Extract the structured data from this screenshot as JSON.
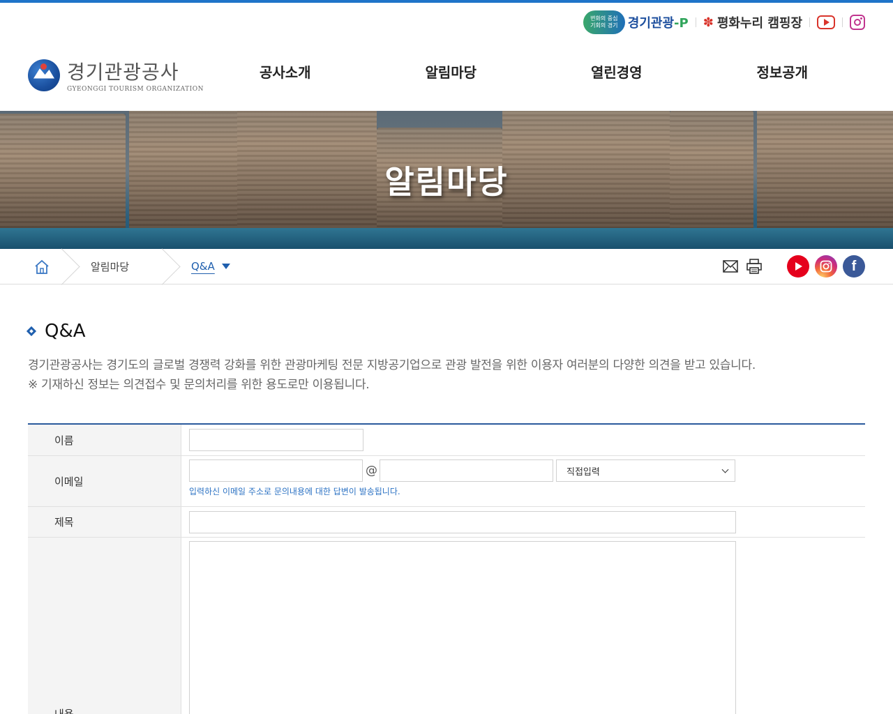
{
  "utility": {
    "badge_line1": "변화의 중심",
    "badge_line2": "기회의 경기",
    "gg_brand": "경기관광",
    "gg_brand_suffix": "-P",
    "peace_brand": "평화누리 캠핑장",
    "youtube_icon": "youtube-icon",
    "instagram_icon": "instagram-icon"
  },
  "logo": {
    "ko": "경기관광공사",
    "en": "GYEONGGI TOURISM ORGANIZATION"
  },
  "nav": [
    "공사소개",
    "알림마당",
    "열린경영",
    "정보공개"
  ],
  "hero": {
    "title": "알림마당"
  },
  "breadcrumb": {
    "home_icon": "home-icon",
    "level1": "알림마당",
    "level2": "Q&A"
  },
  "tools": [
    "mail-icon",
    "print-icon",
    "youtube-icon",
    "instagram-icon",
    "facebook-icon"
  ],
  "page": {
    "title": "Q&A",
    "intro_line1": "경기관광공사는 경기도의 글로벌 경쟁력 강화를 위한 관광마케팅 전문 지방공기업으로 관광 발전을 위한 이용자 여러분의 다양한 의견을 받고 있습니다.",
    "intro_line2": "※ 기재하신 정보는 의견접수 및 문의처리를 위한 용도로만 이용됩니다."
  },
  "form": {
    "name_label": "이름",
    "email_label": "이메일",
    "email_at": "@",
    "email_domain_select": "직접입력",
    "email_hint": "입력하신 이메일 주소로 문의내용에 대한 답변이 발송됩니다.",
    "subject_label": "제목",
    "content_label": "내용",
    "name_value": "",
    "email_id_value": "",
    "email_domain_value": "",
    "subject_value": "",
    "content_value": ""
  },
  "colors": {
    "accent": "#1f74c9",
    "table_border": "#2a5a9c",
    "hint": "#2d73c4"
  }
}
